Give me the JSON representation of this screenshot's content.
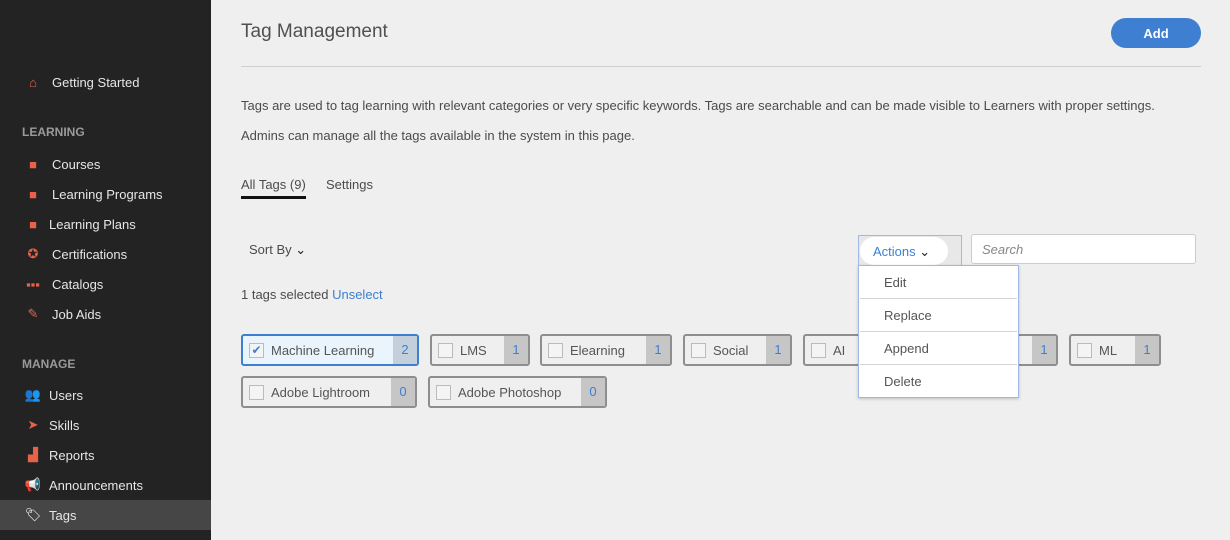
{
  "sidebar": {
    "getting_started": "Getting Started",
    "learning_heading": "LEARNING",
    "learning": [
      {
        "label": "Courses",
        "icon": "book-icon"
      },
      {
        "label": "Learning Programs",
        "icon": "learning-program-icon"
      },
      {
        "label": "Learning Plans",
        "icon": "learning-plan-icon"
      },
      {
        "label": "Certifications",
        "icon": "certificate-icon"
      },
      {
        "label": "Catalogs",
        "icon": "grid-icon"
      },
      {
        "label": "Job Aids",
        "icon": "pin-icon"
      }
    ],
    "manage_heading": "MANAGE",
    "manage": [
      {
        "label": "Users",
        "icon": "users-icon"
      },
      {
        "label": "Skills",
        "icon": "paper-plane-icon"
      },
      {
        "label": "Reports",
        "icon": "bar-chart-icon"
      },
      {
        "label": "Announcements",
        "icon": "megaphone-icon"
      },
      {
        "label": "Tags",
        "icon": "tag-icon",
        "active": true
      }
    ]
  },
  "header": {
    "title": "Tag Management",
    "add_label": "Add"
  },
  "description": [
    "Tags are used to tag learning with relevant categories or very specific keywords. Tags are searchable and can be made visible to Learners with proper settings.",
    "Admins can manage all the tags available in the system in this page."
  ],
  "tabs": [
    {
      "label": "All Tags (9)",
      "active": true
    },
    {
      "label": "Settings"
    }
  ],
  "toolbar": {
    "sort_label": "Sort By",
    "actions_label": "Actions",
    "search_placeholder": "Search",
    "selected_text": "1 tags selected",
    "unselect_label": "Unselect"
  },
  "actions_menu": [
    "Edit",
    "Replace",
    "Append",
    "Delete"
  ],
  "tags": [
    {
      "name": "Machine Learning",
      "count": "2",
      "checked": true
    },
    {
      "name": "LMS",
      "count": "1"
    },
    {
      "name": "Elearning",
      "count": "1"
    },
    {
      "name": "Social",
      "count": "1"
    },
    {
      "name": "AI",
      "count": ""
    },
    {
      "name": "",
      "count": "1"
    },
    {
      "name": "ML",
      "count": "1"
    },
    {
      "name": "Adobe Lightroom",
      "count": "0"
    },
    {
      "name": "Adobe Photoshop",
      "count": "0"
    }
  ],
  "colors": {
    "accent": "#3e7fd1",
    "sidebar_bg": "#232323",
    "icon": "#e8624a"
  }
}
